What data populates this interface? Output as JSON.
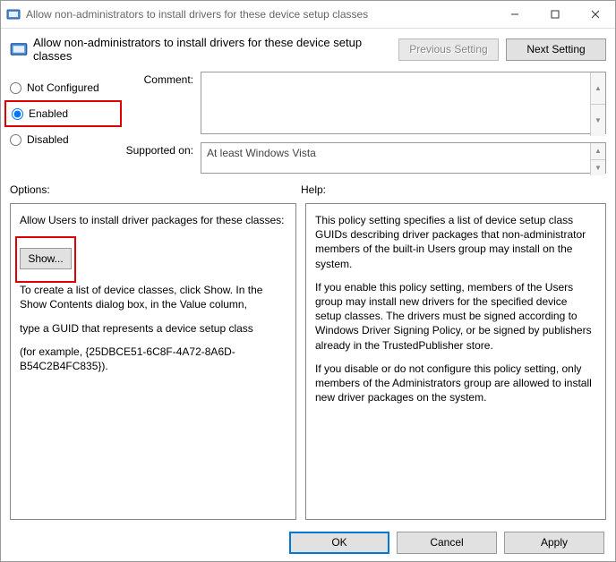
{
  "window": {
    "title": "Allow non-administrators to install drivers for these device setup classes"
  },
  "header": {
    "title": "Allow non-administrators to install drivers for these device setup classes",
    "prev": "Previous Setting",
    "next": "Next Setting"
  },
  "radios": {
    "not_configured": "Not Configured",
    "enabled": "Enabled",
    "disabled": "Disabled"
  },
  "comment_label": "Comment:",
  "supported_label": "Supported on:",
  "supported_value": "At least Windows Vista",
  "options_label": "Options:",
  "help_label": "Help:",
  "options": {
    "intro": "Allow Users to install driver packages for these classes:",
    "show": "Show...",
    "p1": "To create a list of device classes, click Show. In the Show Contents dialog box, in the Value column,",
    "p2": "type a GUID that represents a device setup class",
    "p3": "(for example, {25DBCE51-6C8F-4A72-8A6D-B54C2B4FC835})."
  },
  "help": {
    "p1": "This policy setting specifies a list of device setup class GUIDs describing driver packages that non-administrator members of the built-in Users group may install on the system.",
    "p2": "If you enable this policy setting, members of the Users group may install new drivers for the specified device setup classes. The drivers must be signed according to Windows Driver Signing Policy, or be signed by publishers already in the TrustedPublisher store.",
    "p3": "If you disable or do not configure this policy setting, only members of the Administrators group are allowed to install new driver packages on the system."
  },
  "footer": {
    "ok": "OK",
    "cancel": "Cancel",
    "apply": "Apply"
  }
}
